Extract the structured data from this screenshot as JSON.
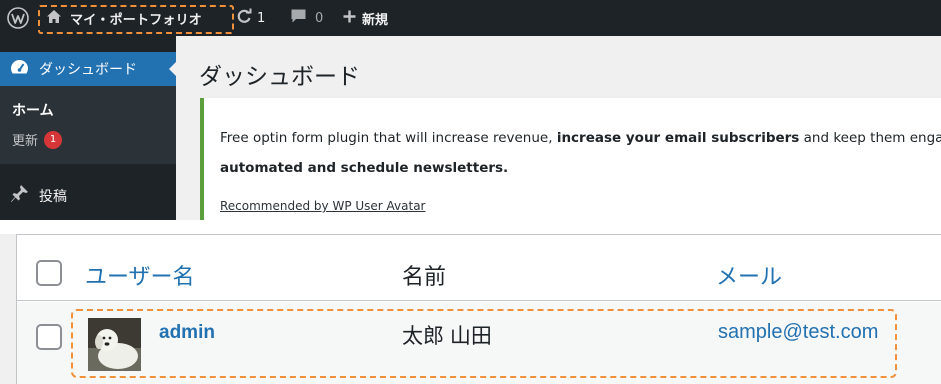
{
  "admin_bar": {
    "wp_logo_icon": "wordpress-logo-icon",
    "site_name": "マイ・ポートフォリオ",
    "updates_count": "1",
    "comments_count": "0",
    "new_label": "新規"
  },
  "sidebar": {
    "dashboard_label": "ダッシュボード",
    "submenu": {
      "home_label": "ホーム",
      "updates_label": "更新",
      "updates_badge": "1"
    },
    "posts_label": "投稿"
  },
  "main": {
    "page_title": "ダッシュボード",
    "notice": {
      "line1_plain_start": "Free optin form plugin that will increase revenue, ",
      "line1_bold": "increase your email subscribers",
      "line1_plain_end": " and keep them engaged",
      "line2": "automated and schedule newsletters.",
      "link": "Recommended by WP User Avatar"
    }
  },
  "users_table": {
    "columns": [
      "ユーザー名",
      "名前",
      "メール"
    ],
    "rows": [
      {
        "username": "admin",
        "name": "太郎 山田",
        "email": "sample@test.com"
      }
    ]
  },
  "colors": {
    "admin_bar_bg": "#1d2327",
    "accent_blue": "#2271b1",
    "highlight_dash": "#f0903a",
    "badge_red": "#d63638"
  }
}
